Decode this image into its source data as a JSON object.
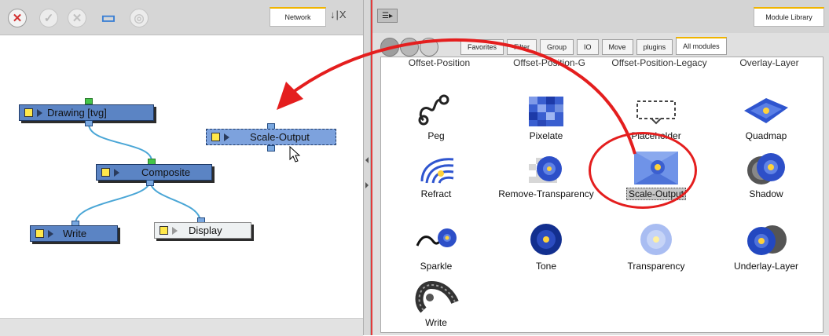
{
  "network": {
    "tab_label": "Network",
    "pane_controls": "↓|X",
    "toolbar_buttons": [
      {
        "icon": "delete-icon",
        "glyph": "✕",
        "color": "#d23030"
      },
      {
        "icon": "check-icon",
        "glyph": "✓",
        "color": "#b9b9b9"
      },
      {
        "icon": "cancel-icon",
        "glyph": "✕",
        "color": "#c0c0c0"
      },
      {
        "icon": "display-icon",
        "glyph": "▭",
        "color": "#3a7fd4"
      },
      {
        "icon": "disk-icon",
        "glyph": "◎",
        "color": "#c6c6c6"
      }
    ],
    "nodes": {
      "drawing": "Drawing [tvg]",
      "composite": "Composite",
      "write": "Write",
      "display": "Display",
      "scale_output": "Scale-Output"
    }
  },
  "library": {
    "menu_label": "☰▸",
    "tab_label": "Module Library",
    "round_buttons": [
      "module-library-icon-a",
      "module-library-icon-b",
      "module-library-icon-c"
    ],
    "categories": [
      "Favorites",
      "Filter",
      "Group",
      "IO",
      "Move",
      "plugins",
      "All modules"
    ],
    "active_category": "All modules",
    "partial_labels": [
      "Offset-Position",
      "Offset-Position-G",
      "Offset-Position-Legacy",
      "Overlay-Layer"
    ],
    "modules": [
      {
        "label": "Peg",
        "icon": "peg-icon"
      },
      {
        "label": "Pixelate",
        "icon": "pixelate-icon"
      },
      {
        "label": "Placeholder",
        "icon": "placeholder-icon"
      },
      {
        "label": "Quadmap",
        "icon": "quadmap-icon"
      },
      {
        "label": "Refract",
        "icon": "refract-icon"
      },
      {
        "label": "Remove-Transparency",
        "icon": "remove-transparency-icon"
      },
      {
        "label": "Scale-Output",
        "icon": "scale-output-icon",
        "selected": true
      },
      {
        "label": "Shadow",
        "icon": "shadow-icon"
      },
      {
        "label": "Sparkle",
        "icon": "sparkle-icon"
      },
      {
        "label": "Tone",
        "icon": "tone-icon"
      },
      {
        "label": "Transparency",
        "icon": "transparency-icon"
      },
      {
        "label": "Underlay-Layer",
        "icon": "underlay-layer-icon"
      },
      {
        "label": "Write",
        "icon": "write-icon"
      }
    ]
  },
  "colors": {
    "node_blue": "#5b84c4",
    "node_selected": "#7da2dd",
    "wire": "#4aa6d6",
    "annotation_red": "#e41e1e",
    "tab_accent": "#f0b400"
  }
}
